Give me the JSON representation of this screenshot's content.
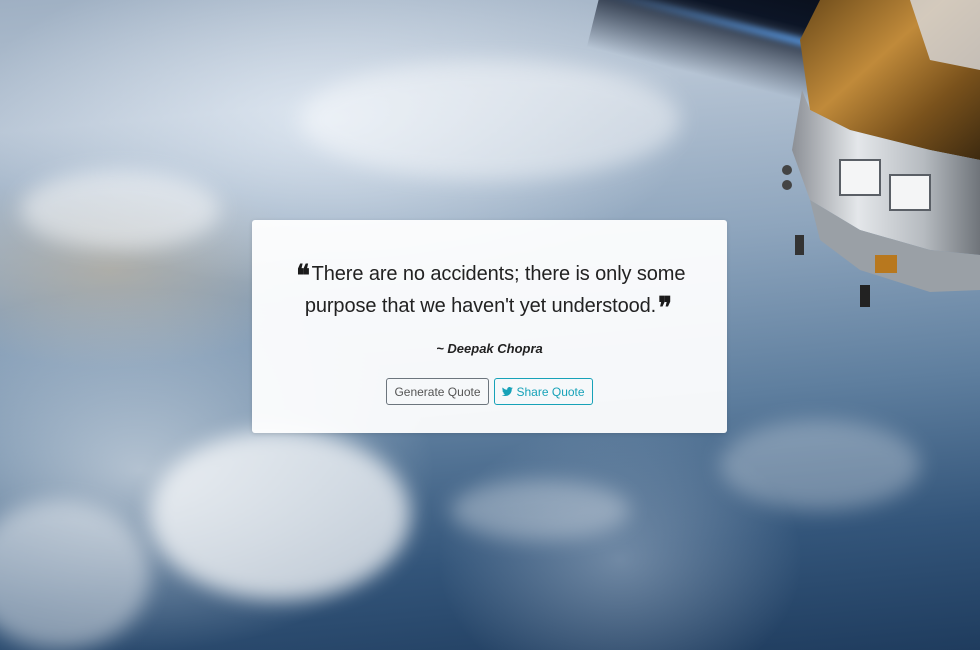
{
  "quote": {
    "open_mark": "❝",
    "text": "There are no accidents; there is only some purpose that we haven't yet understood.",
    "close_mark": "❞",
    "author": "~ Deepak Chopra"
  },
  "buttons": {
    "generate_label": "Generate Quote",
    "share_label": "Share Quote",
    "share_icon": "twitter-icon"
  },
  "colors": {
    "share_accent": "#17a2b8",
    "generate_border": "#6c757d"
  }
}
